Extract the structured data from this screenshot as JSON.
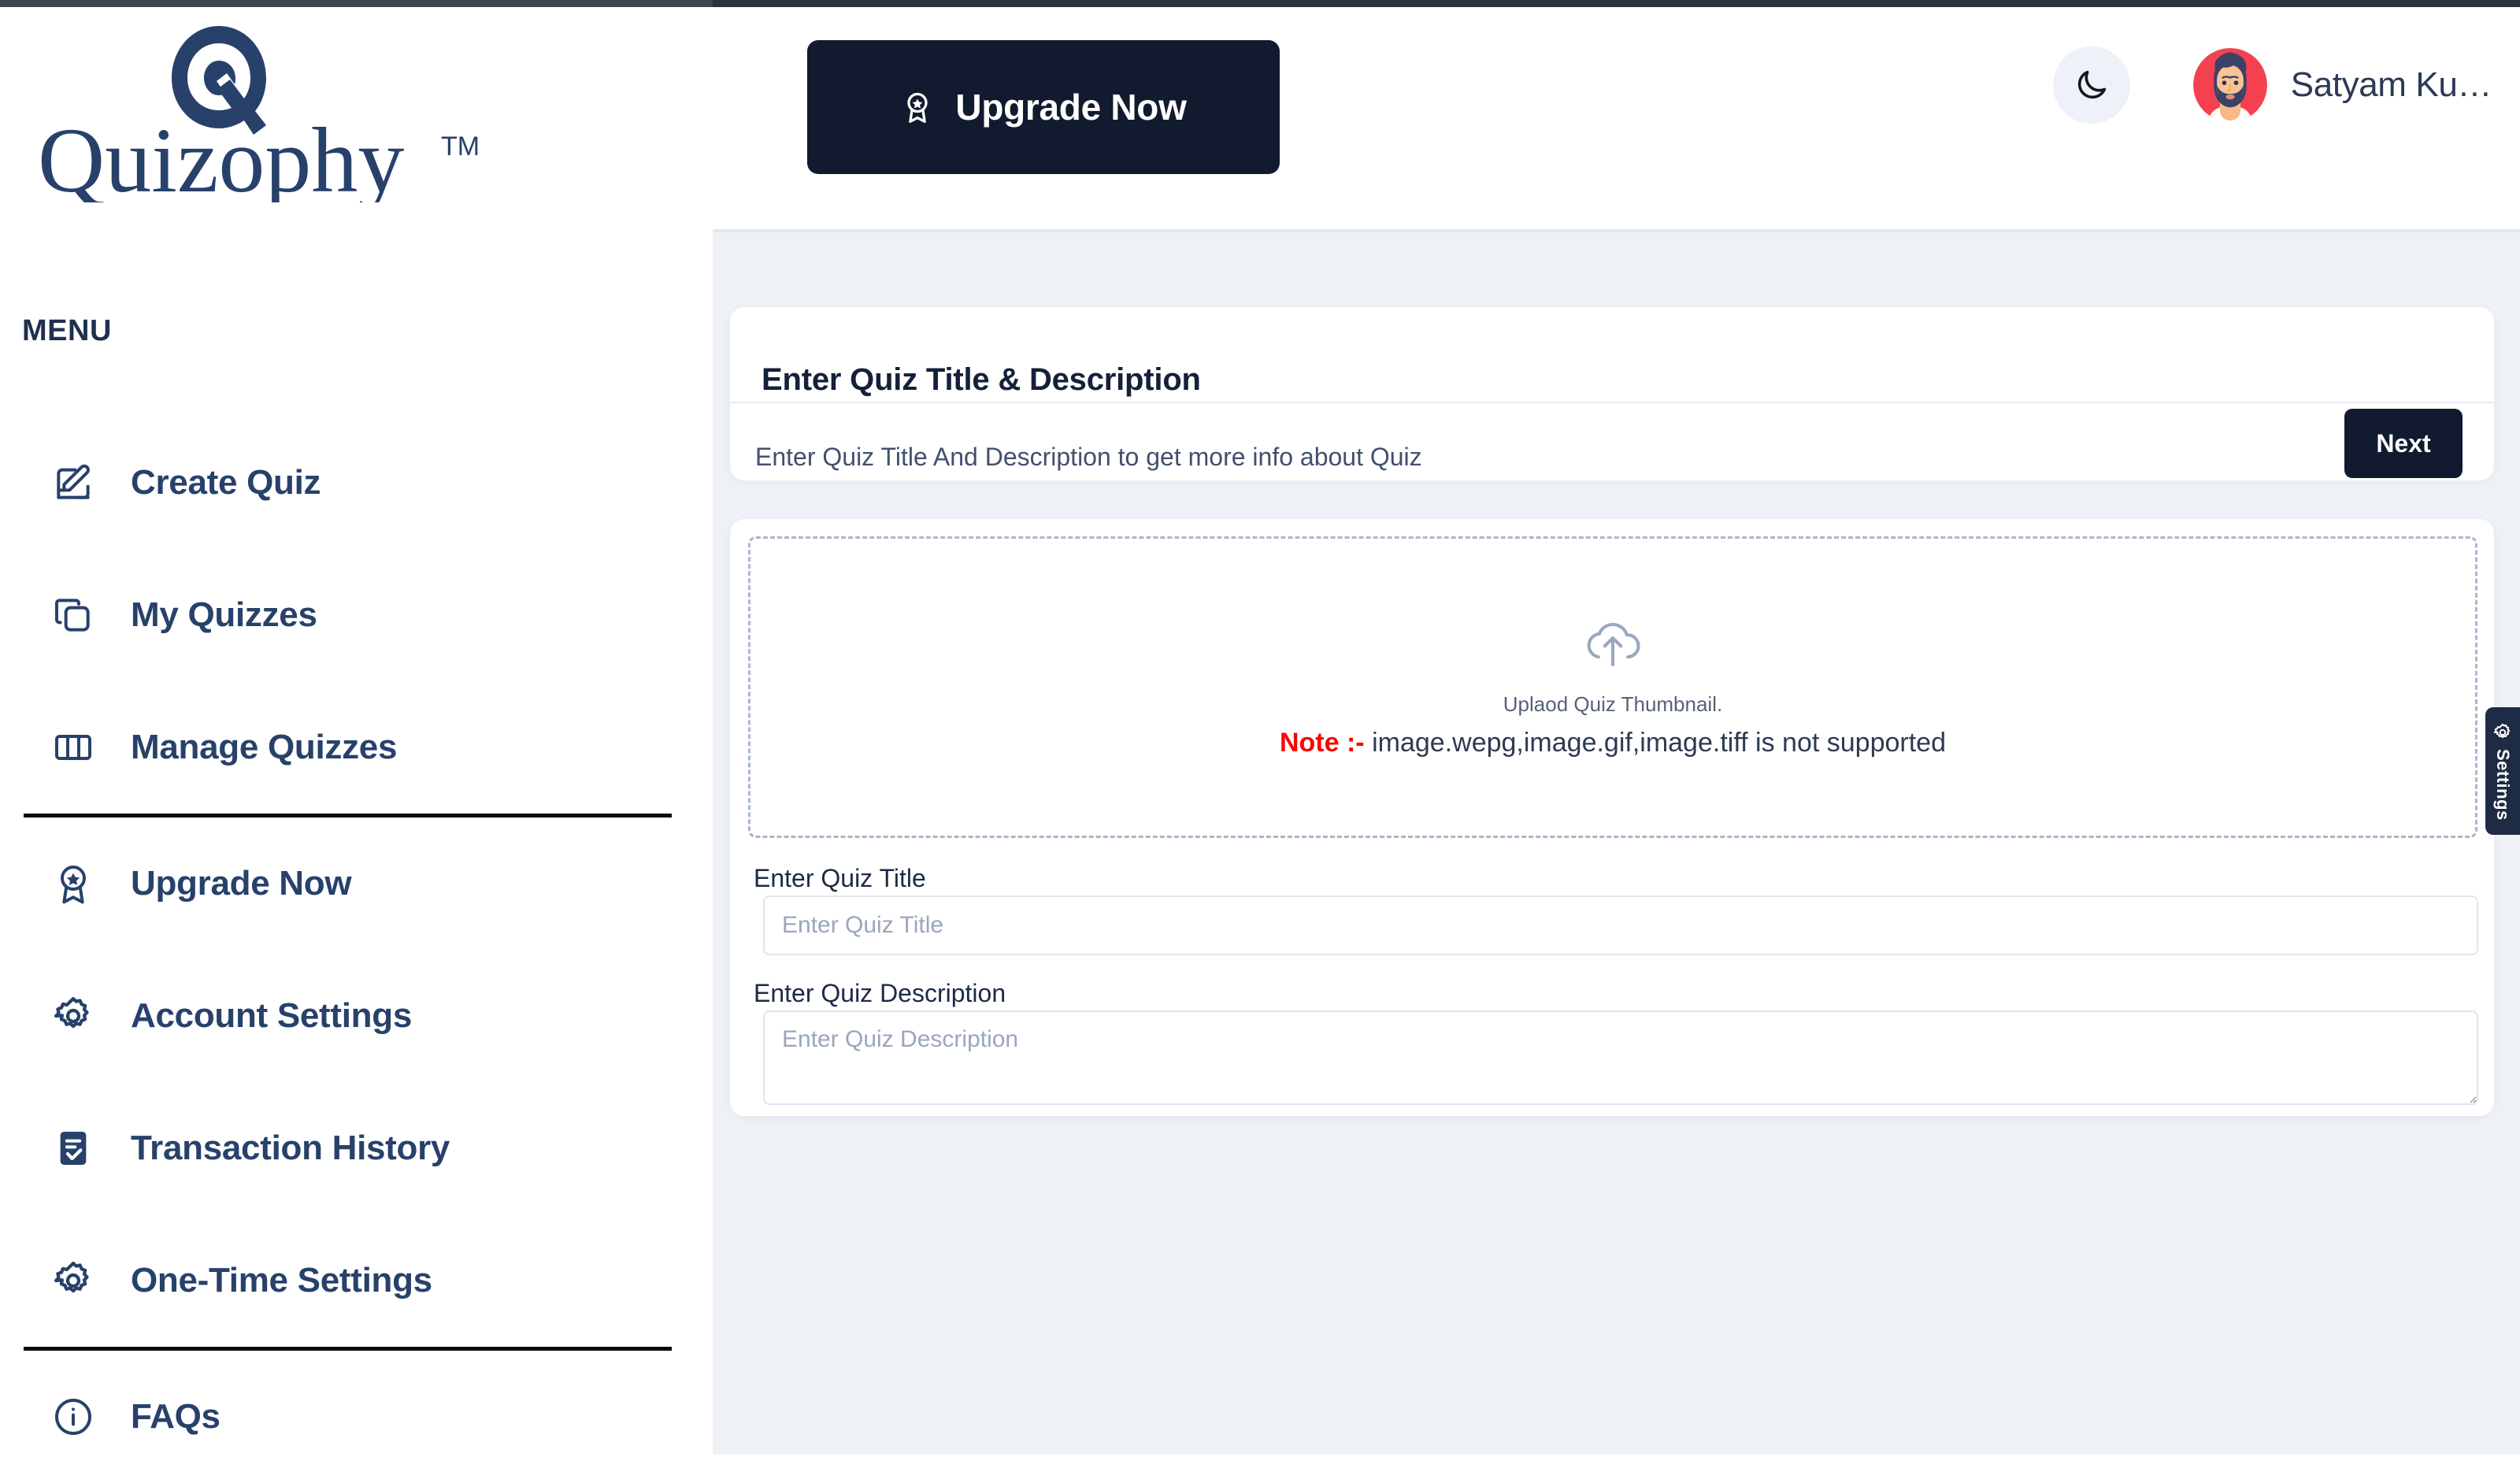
{
  "brand": {
    "name": "Quizophy",
    "trademark": "TM",
    "logo_icon": "quizophy-q-logo",
    "color": "#27416b"
  },
  "header": {
    "upgrade_button": {
      "label": "Upgrade Now",
      "icon": "award-badge-icon",
      "background": "#111a2e",
      "text_color": "#ffffff"
    },
    "darkmode_toggle": {
      "icon": "moon-icon",
      "background": "#eef1f7"
    },
    "user": {
      "name": "Satyam Ku…",
      "avatar_icon": "bearded-man-avatar",
      "avatar_background": "#f4414f"
    }
  },
  "sidebar": {
    "section_label": "MENU",
    "items": [
      {
        "label": "Create Quiz",
        "icon": "pencil-square-icon"
      },
      {
        "label": "My Quizzes",
        "icon": "copy-layers-icon"
      },
      {
        "label": "Manage Quizzes",
        "icon": "columns-icon"
      },
      {
        "label": "Upgrade Now",
        "icon": "award-badge-icon"
      },
      {
        "label": "Account Settings",
        "icon": "gear-icon"
      },
      {
        "label": "Transaction History",
        "icon": "document-check-icon"
      },
      {
        "label": "One-Time Settings",
        "icon": "gear-icon"
      },
      {
        "label": "FAQs",
        "icon": "info-circle-icon"
      }
    ]
  },
  "main": {
    "card": {
      "title": "Enter Quiz Title & Description",
      "subtitle": "Enter Quiz Title And Description to get more info about Quiz",
      "next_button": "Next"
    },
    "dropzone": {
      "icon": "cloud-upload-icon",
      "caption": "Uplaod Quiz Thumbnail.",
      "note_prefix": "Note :-",
      "note_text": "image.wepg,image.gif,image.tiff is not supported",
      "note_prefix_color": "#ff0000"
    },
    "form": {
      "title_label": "Enter Quiz Title",
      "title_value": "",
      "title_placeholder": "Enter Quiz Title",
      "description_label": "Enter Quiz Description",
      "description_value": "",
      "description_placeholder": "Enter Quiz Description"
    }
  },
  "settings_tab": {
    "label": "Settings",
    "icon": "gear-icon",
    "background": "#1d2b44"
  }
}
